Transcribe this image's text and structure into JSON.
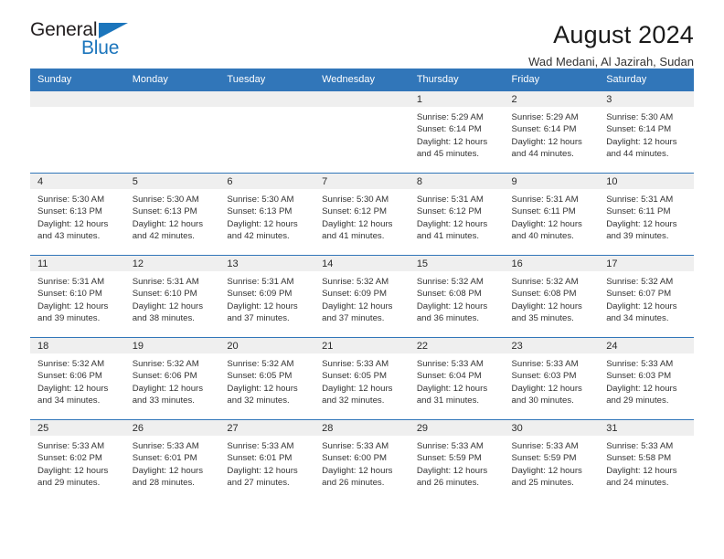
{
  "brand": {
    "name_part1": "General",
    "name_part2": "Blue",
    "accent_color": "#1b75bc",
    "triangle_icon": "triangle-icon"
  },
  "header": {
    "title": "August 2024",
    "location": "Wad Medani, Al Jazirah, Sudan"
  },
  "theme": {
    "header_blue": "#3176b9",
    "date_band_gray": "#efefef",
    "text_dark": "#333333"
  },
  "weekdays": [
    "Sunday",
    "Monday",
    "Tuesday",
    "Wednesday",
    "Thursday",
    "Friday",
    "Saturday"
  ],
  "labels": {
    "sunrise": "Sunrise:",
    "sunset": "Sunset:",
    "daylight": "Daylight:"
  },
  "weeks": [
    [
      {
        "date": "",
        "empty": true
      },
      {
        "date": "",
        "empty": true
      },
      {
        "date": "",
        "empty": true
      },
      {
        "date": "",
        "empty": true
      },
      {
        "date": "1",
        "sunrise": "Sunrise: 5:29 AM",
        "sunset": "Sunset: 6:14 PM",
        "daylight_line1": "Daylight: 12 hours",
        "daylight_line2": "and 45 minutes."
      },
      {
        "date": "2",
        "sunrise": "Sunrise: 5:29 AM",
        "sunset": "Sunset: 6:14 PM",
        "daylight_line1": "Daylight: 12 hours",
        "daylight_line2": "and 44 minutes."
      },
      {
        "date": "3",
        "sunrise": "Sunrise: 5:30 AM",
        "sunset": "Sunset: 6:14 PM",
        "daylight_line1": "Daylight: 12 hours",
        "daylight_line2": "and 44 minutes."
      }
    ],
    [
      {
        "date": "4",
        "sunrise": "Sunrise: 5:30 AM",
        "sunset": "Sunset: 6:13 PM",
        "daylight_line1": "Daylight: 12 hours",
        "daylight_line2": "and 43 minutes."
      },
      {
        "date": "5",
        "sunrise": "Sunrise: 5:30 AM",
        "sunset": "Sunset: 6:13 PM",
        "daylight_line1": "Daylight: 12 hours",
        "daylight_line2": "and 42 minutes."
      },
      {
        "date": "6",
        "sunrise": "Sunrise: 5:30 AM",
        "sunset": "Sunset: 6:13 PM",
        "daylight_line1": "Daylight: 12 hours",
        "daylight_line2": "and 42 minutes."
      },
      {
        "date": "7",
        "sunrise": "Sunrise: 5:30 AM",
        "sunset": "Sunset: 6:12 PM",
        "daylight_line1": "Daylight: 12 hours",
        "daylight_line2": "and 41 minutes."
      },
      {
        "date": "8",
        "sunrise": "Sunrise: 5:31 AM",
        "sunset": "Sunset: 6:12 PM",
        "daylight_line1": "Daylight: 12 hours",
        "daylight_line2": "and 41 minutes."
      },
      {
        "date": "9",
        "sunrise": "Sunrise: 5:31 AM",
        "sunset": "Sunset: 6:11 PM",
        "daylight_line1": "Daylight: 12 hours",
        "daylight_line2": "and 40 minutes."
      },
      {
        "date": "10",
        "sunrise": "Sunrise: 5:31 AM",
        "sunset": "Sunset: 6:11 PM",
        "daylight_line1": "Daylight: 12 hours",
        "daylight_line2": "and 39 minutes."
      }
    ],
    [
      {
        "date": "11",
        "sunrise": "Sunrise: 5:31 AM",
        "sunset": "Sunset: 6:10 PM",
        "daylight_line1": "Daylight: 12 hours",
        "daylight_line2": "and 39 minutes."
      },
      {
        "date": "12",
        "sunrise": "Sunrise: 5:31 AM",
        "sunset": "Sunset: 6:10 PM",
        "daylight_line1": "Daylight: 12 hours",
        "daylight_line2": "and 38 minutes."
      },
      {
        "date": "13",
        "sunrise": "Sunrise: 5:31 AM",
        "sunset": "Sunset: 6:09 PM",
        "daylight_line1": "Daylight: 12 hours",
        "daylight_line2": "and 37 minutes."
      },
      {
        "date": "14",
        "sunrise": "Sunrise: 5:32 AM",
        "sunset": "Sunset: 6:09 PM",
        "daylight_line1": "Daylight: 12 hours",
        "daylight_line2": "and 37 minutes."
      },
      {
        "date": "15",
        "sunrise": "Sunrise: 5:32 AM",
        "sunset": "Sunset: 6:08 PM",
        "daylight_line1": "Daylight: 12 hours",
        "daylight_line2": "and 36 minutes."
      },
      {
        "date": "16",
        "sunrise": "Sunrise: 5:32 AM",
        "sunset": "Sunset: 6:08 PM",
        "daylight_line1": "Daylight: 12 hours",
        "daylight_line2": "and 35 minutes."
      },
      {
        "date": "17",
        "sunrise": "Sunrise: 5:32 AM",
        "sunset": "Sunset: 6:07 PM",
        "daylight_line1": "Daylight: 12 hours",
        "daylight_line2": "and 34 minutes."
      }
    ],
    [
      {
        "date": "18",
        "sunrise": "Sunrise: 5:32 AM",
        "sunset": "Sunset: 6:06 PM",
        "daylight_line1": "Daylight: 12 hours",
        "daylight_line2": "and 34 minutes."
      },
      {
        "date": "19",
        "sunrise": "Sunrise: 5:32 AM",
        "sunset": "Sunset: 6:06 PM",
        "daylight_line1": "Daylight: 12 hours",
        "daylight_line2": "and 33 minutes."
      },
      {
        "date": "20",
        "sunrise": "Sunrise: 5:32 AM",
        "sunset": "Sunset: 6:05 PM",
        "daylight_line1": "Daylight: 12 hours",
        "daylight_line2": "and 32 minutes."
      },
      {
        "date": "21",
        "sunrise": "Sunrise: 5:33 AM",
        "sunset": "Sunset: 6:05 PM",
        "daylight_line1": "Daylight: 12 hours",
        "daylight_line2": "and 32 minutes."
      },
      {
        "date": "22",
        "sunrise": "Sunrise: 5:33 AM",
        "sunset": "Sunset: 6:04 PM",
        "daylight_line1": "Daylight: 12 hours",
        "daylight_line2": "and 31 minutes."
      },
      {
        "date": "23",
        "sunrise": "Sunrise: 5:33 AM",
        "sunset": "Sunset: 6:03 PM",
        "daylight_line1": "Daylight: 12 hours",
        "daylight_line2": "and 30 minutes."
      },
      {
        "date": "24",
        "sunrise": "Sunrise: 5:33 AM",
        "sunset": "Sunset: 6:03 PM",
        "daylight_line1": "Daylight: 12 hours",
        "daylight_line2": "and 29 minutes."
      }
    ],
    [
      {
        "date": "25",
        "sunrise": "Sunrise: 5:33 AM",
        "sunset": "Sunset: 6:02 PM",
        "daylight_line1": "Daylight: 12 hours",
        "daylight_line2": "and 29 minutes."
      },
      {
        "date": "26",
        "sunrise": "Sunrise: 5:33 AM",
        "sunset": "Sunset: 6:01 PM",
        "daylight_line1": "Daylight: 12 hours",
        "daylight_line2": "and 28 minutes."
      },
      {
        "date": "27",
        "sunrise": "Sunrise: 5:33 AM",
        "sunset": "Sunset: 6:01 PM",
        "daylight_line1": "Daylight: 12 hours",
        "daylight_line2": "and 27 minutes."
      },
      {
        "date": "28",
        "sunrise": "Sunrise: 5:33 AM",
        "sunset": "Sunset: 6:00 PM",
        "daylight_line1": "Daylight: 12 hours",
        "daylight_line2": "and 26 minutes."
      },
      {
        "date": "29",
        "sunrise": "Sunrise: 5:33 AM",
        "sunset": "Sunset: 5:59 PM",
        "daylight_line1": "Daylight: 12 hours",
        "daylight_line2": "and 26 minutes."
      },
      {
        "date": "30",
        "sunrise": "Sunrise: 5:33 AM",
        "sunset": "Sunset: 5:59 PM",
        "daylight_line1": "Daylight: 12 hours",
        "daylight_line2": "and 25 minutes."
      },
      {
        "date": "31",
        "sunrise": "Sunrise: 5:33 AM",
        "sunset": "Sunset: 5:58 PM",
        "daylight_line1": "Daylight: 12 hours",
        "daylight_line2": "and 24 minutes."
      }
    ]
  ]
}
